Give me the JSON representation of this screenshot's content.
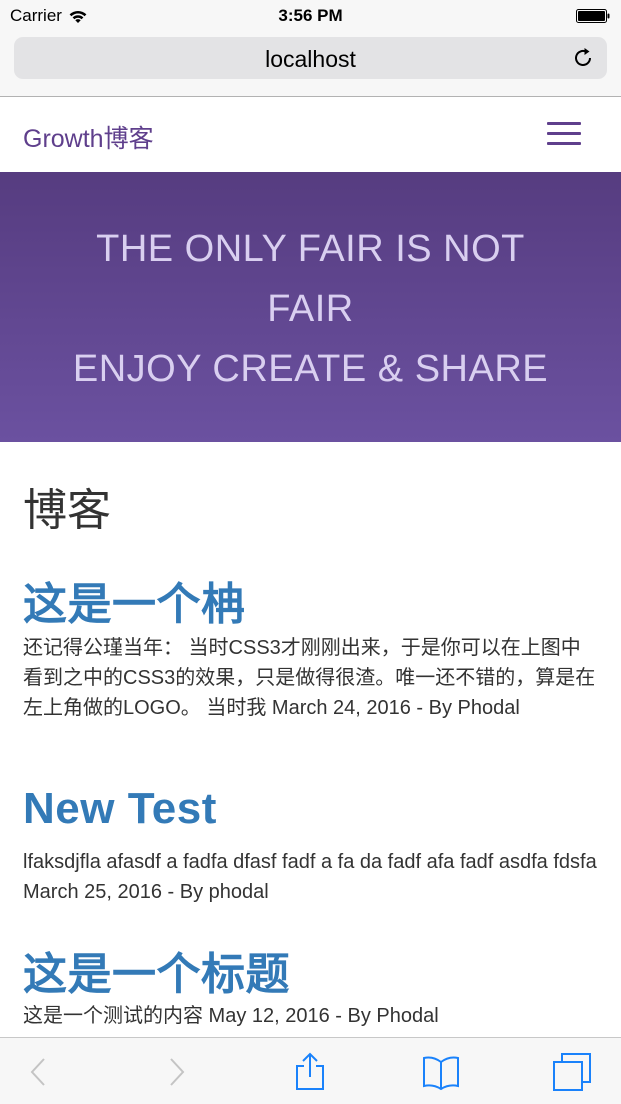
{
  "status_bar": {
    "carrier": "Carrier",
    "time": "3:56 PM"
  },
  "browser": {
    "url": "localhost",
    "icons": {
      "reload": "reload-icon",
      "back": "chevron-left-icon",
      "forward": "chevron-right-icon",
      "share": "share-icon",
      "bookmarks": "book-icon",
      "tabs": "tabs-icon"
    }
  },
  "nav": {
    "brand": "Growth博客",
    "menu_icon": "hamburger-icon"
  },
  "hero": {
    "line1": "THE ONLY FAIR IS NOT",
    "line2": "FAIR",
    "line3": "ENJOY CREATE & SHARE"
  },
  "content": {
    "section_title": "博客",
    "posts": [
      {
        "title": "这是一个柟",
        "excerpt": "还记得公瑾当年： 当时CSS3才刚刚出来，于是你可以在上图中看到之中的CSS3的效果，只是做得很渣。唯一还不错的，算是在左上角做的LOGO。 当时我 March 24, 2016 - By Phodal"
      },
      {
        "title": "New Test",
        "excerpt": "lfaksdjfla afasdf a fadfa dfasf fadf a fa da fadf afa fadf asdfa fdsfa March 25, 2016 - By phodal"
      },
      {
        "title": "这是一个标题",
        "excerpt": "这是一个测试的内容 May 12, 2016 - By Phodal"
      }
    ]
  },
  "colors": {
    "brand": "#5f3f8c",
    "hero_top": "#563c80",
    "hero_bottom": "#6b51a0",
    "link": "#337ab7",
    "text": "#333333"
  }
}
